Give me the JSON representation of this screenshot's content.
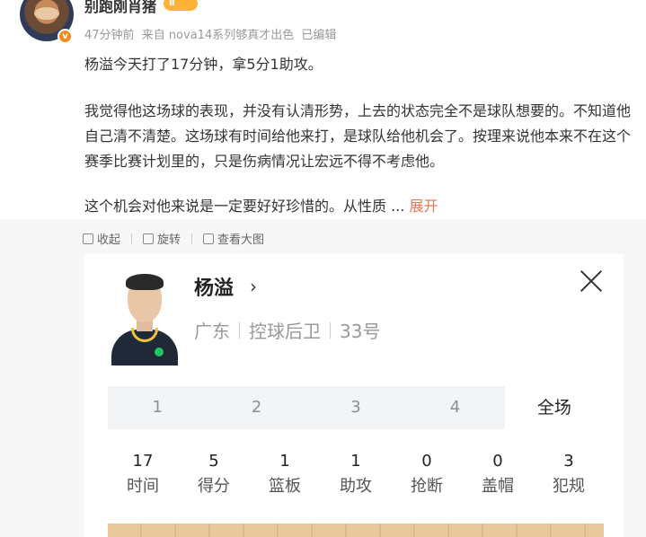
{
  "post": {
    "username": "别跑刚肖猪",
    "level_badge": "Ⅱ",
    "verified_badge": "v",
    "meta": {
      "time": "47分钟前",
      "source": "来自 nova14系列够真才出色",
      "edited": "已编辑"
    },
    "paragraphs": [
      "杨溢今天打了17分钟，拿5分1助攻。",
      "我觉得他这场球的表现，并没有认清形势，上去的状态完全不是球队想要的。不知道他自己清不清楚。这场球有时间给他来打，是球队给他机会了。按理来说他本来不在这个赛季比赛计划里的，只是伤病情况让宏远不得不考虑他。",
      "这个机会对他来说是一定要好好珍惜的。从性质 ..."
    ],
    "expand_label": "展开"
  },
  "toolbar": {
    "collect": "收起",
    "rotate": "旋转",
    "view_large": "查看大图"
  },
  "player_card": {
    "name": "杨溢",
    "chevron": "›",
    "team": "广东",
    "position": "控球后卫",
    "number": "33号",
    "tabs": [
      "1",
      "2",
      "3",
      "4",
      "全场"
    ],
    "active_tab_index": 4,
    "stats": [
      {
        "value": "17",
        "label": "时间"
      },
      {
        "value": "5",
        "label": "得分"
      },
      {
        "value": "1",
        "label": "篮板"
      },
      {
        "value": "1",
        "label": "助攻"
      },
      {
        "value": "0",
        "label": "抢断"
      },
      {
        "value": "0",
        "label": "盖帽"
      },
      {
        "value": "3",
        "label": "犯规"
      }
    ]
  },
  "colors": {
    "accent_link": "#eb7350",
    "badge_orange": "#f28a1e",
    "court_wood": "#e7c89b"
  }
}
